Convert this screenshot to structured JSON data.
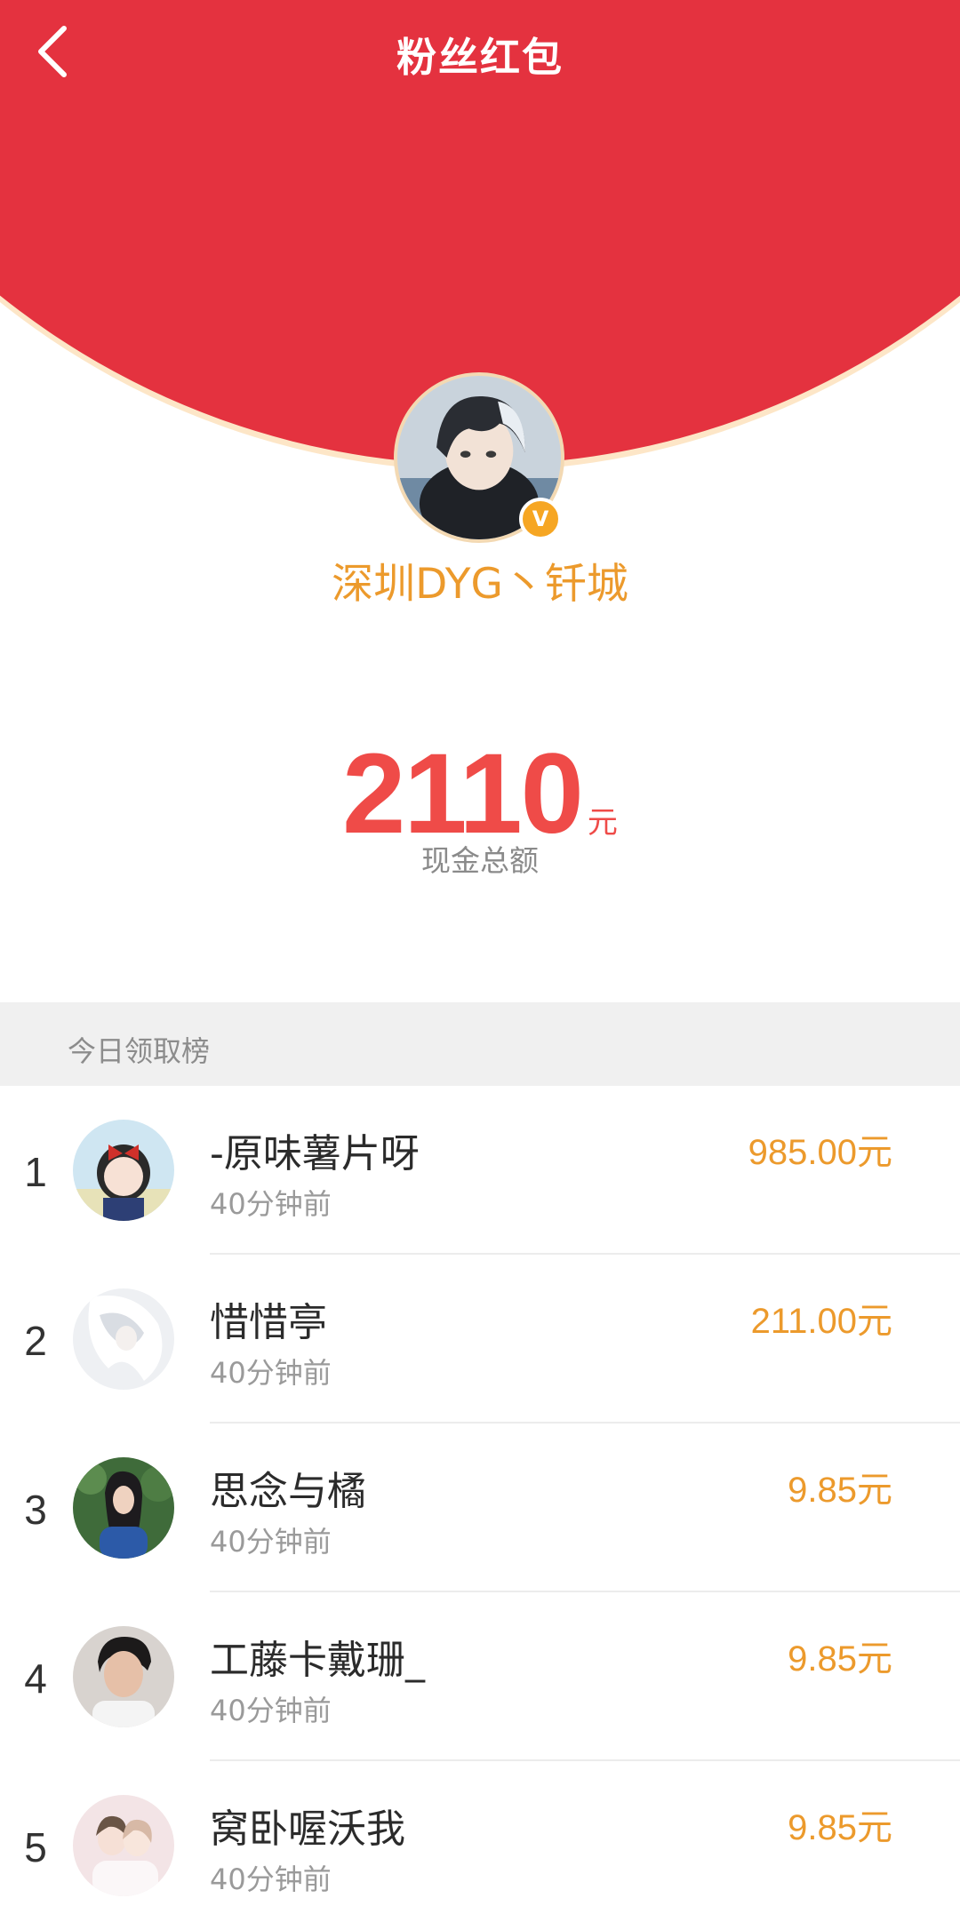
{
  "header": {
    "title": "粉丝红包",
    "back_icon": "chevron-left-icon"
  },
  "host": {
    "name": "深圳DYG丶钎城",
    "badge": "V"
  },
  "total": {
    "amount": "2110",
    "unit": "元",
    "label": "现金总额"
  },
  "leaderboard": {
    "title": "今日领取榜",
    "entries": [
      {
        "rank": "1",
        "name": "-原味薯片呀",
        "time": "40分钟前",
        "amount": "985.00元"
      },
      {
        "rank": "2",
        "name": "惜惜亭",
        "time": "40分钟前",
        "amount": "211.00元"
      },
      {
        "rank": "3",
        "name": "思念与橘",
        "time": "40分钟前",
        "amount": "9.85元"
      },
      {
        "rank": "4",
        "name": "工藤卡戴珊_",
        "time": "40分钟前",
        "amount": "9.85元"
      },
      {
        "rank": "5",
        "name": "窝卧喔沃我",
        "time": "40分钟前",
        "amount": "9.85元"
      }
    ]
  },
  "colors": {
    "header_red": "#e4323f",
    "accent_orange": "#ec9a2c",
    "amount_red": "#ef4b48"
  }
}
